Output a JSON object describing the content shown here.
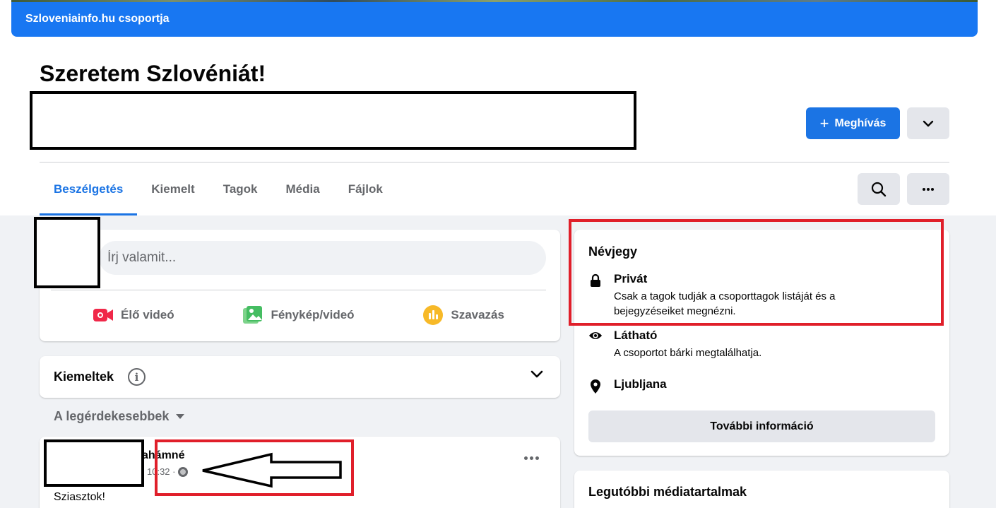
{
  "header": {
    "group_link": "Szloveniainfo.hu csoportja",
    "title": "Szeretem Szlovéniát!",
    "invite_label": "Meghívás"
  },
  "tabs": [
    {
      "label": "Beszélgetés",
      "active": true
    },
    {
      "label": "Kiemelt"
    },
    {
      "label": "Tagok"
    },
    {
      "label": "Média"
    },
    {
      "label": "Fájlok"
    }
  ],
  "composer": {
    "placeholder": "Írj valamit...",
    "actions": [
      {
        "label": "Élő videó",
        "icon": "live-video-icon",
        "color": "#f02849"
      },
      {
        "label": "Fénykép/videó",
        "icon": "photo-icon",
        "color": "#45bd62"
      },
      {
        "label": "Szavazás",
        "icon": "poll-icon",
        "color": "#f7b928"
      }
    ]
  },
  "featured": {
    "title": "Kiemeltek"
  },
  "sort": {
    "label": "A legérdekesebbek"
  },
  "post": {
    "author_partial": "ahámné",
    "time_partial": "10:32 ·",
    "text": "Sziasztok!"
  },
  "about": {
    "title": "Névjegy",
    "private_title": "Privát",
    "private_desc_1": "Csak a tagok tudják a csoporttagok listáját és a",
    "private_desc_2": "bejegyzéseiket megnézni.",
    "visible_title": "Látható",
    "visible_desc": "A csoportot bárki megtalálhatja.",
    "location": "Ljubljana",
    "more_info_label": "További információ"
  },
  "media": {
    "title": "Legutóbbi médiatartalmak"
  },
  "colors": {
    "accent": "#1b74e4",
    "annotation_red": "#e01f2a",
    "background": "#f0f2f5"
  }
}
